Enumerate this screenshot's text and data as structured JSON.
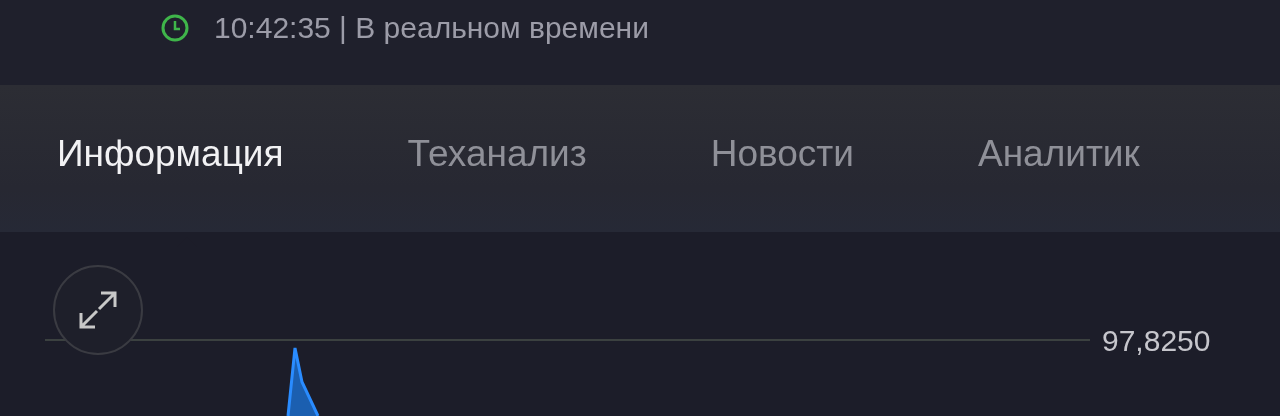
{
  "status": {
    "time": "10:42:35 | В реальном времени"
  },
  "tabs": [
    {
      "label": "Информация",
      "selected": true
    },
    {
      "label": "Теханализ",
      "selected": false
    },
    {
      "label": "Новости",
      "selected": false
    },
    {
      "label": "Аналитик",
      "selected": false
    }
  ],
  "chart": {
    "price_label": "97,8250"
  }
}
